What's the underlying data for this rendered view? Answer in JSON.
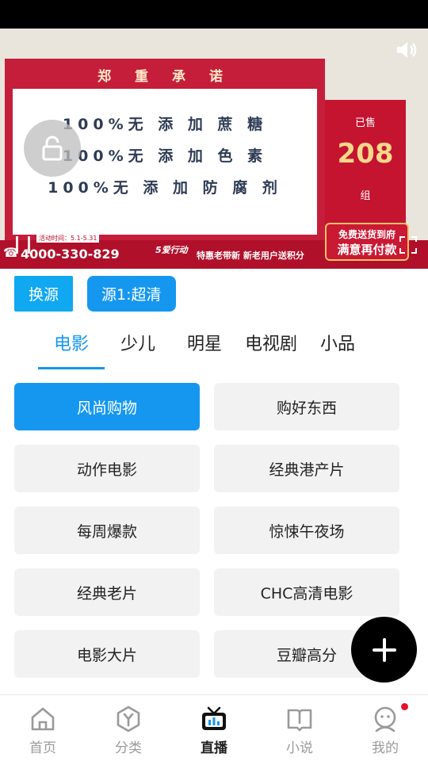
{
  "video": {
    "panel_title": "郑 重 承 诺",
    "promises": [
      "100%无 添 加 蔗 糖",
      "100%无 添 加 色 素",
      "100%无 添 加 防 腐 剂"
    ],
    "sold_label": "已售",
    "sold_count": "208",
    "sold_unit": "组",
    "phone": "4000-330-829",
    "campaign_time": "活动时间：5.1-5.31",
    "campaign_badge": "5爱行动",
    "ticker_text": "特惠老带新  新老用户送积分",
    "delivery_line1": "免费送货到府",
    "delivery_line2": "满意再付款"
  },
  "sources": {
    "switch_label": "换源",
    "current_label": "源1:超清"
  },
  "tabs": [
    "电影",
    "少儿",
    "明星",
    "电视剧",
    "小品"
  ],
  "channels": [
    "风尚购物",
    "购好东西",
    "动作电影",
    "经典港产片",
    "每周爆款",
    "惊悚午夜场",
    "经典老片",
    "CHC高清电影",
    "电影大片",
    "豆瓣高分"
  ],
  "active_channel": "风尚购物",
  "nav": {
    "items": [
      "首页",
      "分类",
      "直播",
      "小说",
      "我的"
    ],
    "active": "直播"
  },
  "colors": {
    "accent": "#1597ef",
    "switch": "#10a8f0",
    "badge": "#e5132d"
  }
}
